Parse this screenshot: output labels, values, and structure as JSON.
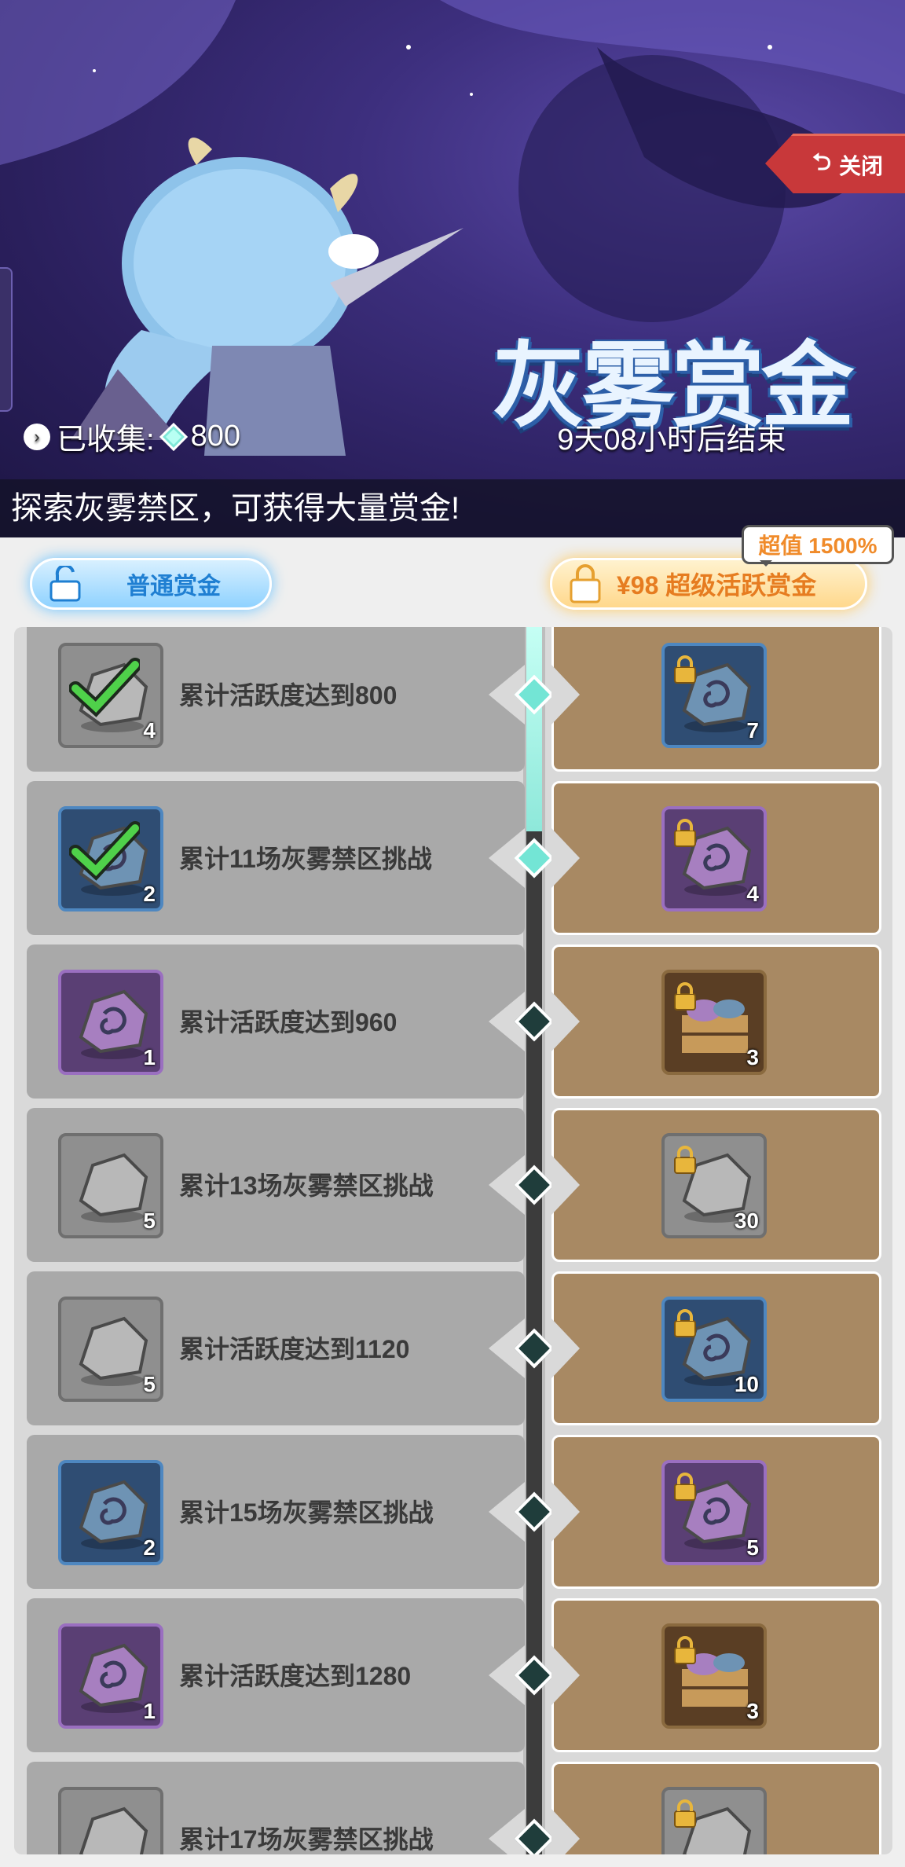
{
  "banner": {
    "title": "灰雾赏金",
    "countdown": "9天08小时后结束",
    "collected_label": "已收集:",
    "collected_value": "800",
    "description": "探索灰雾禁区，可获得大量赏金!",
    "close_label": "关闭"
  },
  "tabs": {
    "normal_label": "普通赏金",
    "premium_label": "¥98 超级活跃赏金",
    "value_badge": "超值 1500%"
  },
  "rows": [
    {
      "label": "累计活跃度达到800",
      "left_qty": "4",
      "left_frame": "gray",
      "left_claimed": true,
      "right_qty": "7",
      "right_frame": "blue",
      "reached": true
    },
    {
      "label": "累计11场灰雾禁区挑战",
      "left_qty": "2",
      "left_frame": "blue",
      "left_claimed": true,
      "right_qty": "4",
      "right_frame": "purple",
      "reached": true
    },
    {
      "label": "累计活跃度达到960",
      "left_qty": "1",
      "left_frame": "purple",
      "left_claimed": false,
      "right_qty": "3",
      "right_frame": "brown",
      "reached": false
    },
    {
      "label": "累计13场灰雾禁区挑战",
      "left_qty": "5",
      "left_frame": "gray",
      "left_claimed": false,
      "right_qty": "30",
      "right_frame": "gray",
      "reached": false
    },
    {
      "label": "累计活跃度达到1120",
      "left_qty": "5",
      "left_frame": "gray",
      "left_claimed": false,
      "right_qty": "10",
      "right_frame": "blue",
      "reached": false
    },
    {
      "label": "累计15场灰雾禁区挑战",
      "left_qty": "2",
      "left_frame": "blue",
      "left_claimed": false,
      "right_qty": "5",
      "right_frame": "purple",
      "reached": false
    },
    {
      "label": "累计活跃度达到1280",
      "left_qty": "1",
      "left_frame": "purple",
      "left_claimed": false,
      "right_qty": "3",
      "right_frame": "brown",
      "reached": false
    },
    {
      "label": "累计17场灰雾禁区挑战",
      "left_qty": "",
      "left_frame": "gray",
      "left_claimed": false,
      "right_qty": "",
      "right_frame": "gray",
      "reached": false
    }
  ],
  "colors": {
    "accent_blue": "#1f7fd2",
    "accent_orange": "#e67c20",
    "close_red": "#c8383a",
    "reached_node": "#73e5d5"
  }
}
